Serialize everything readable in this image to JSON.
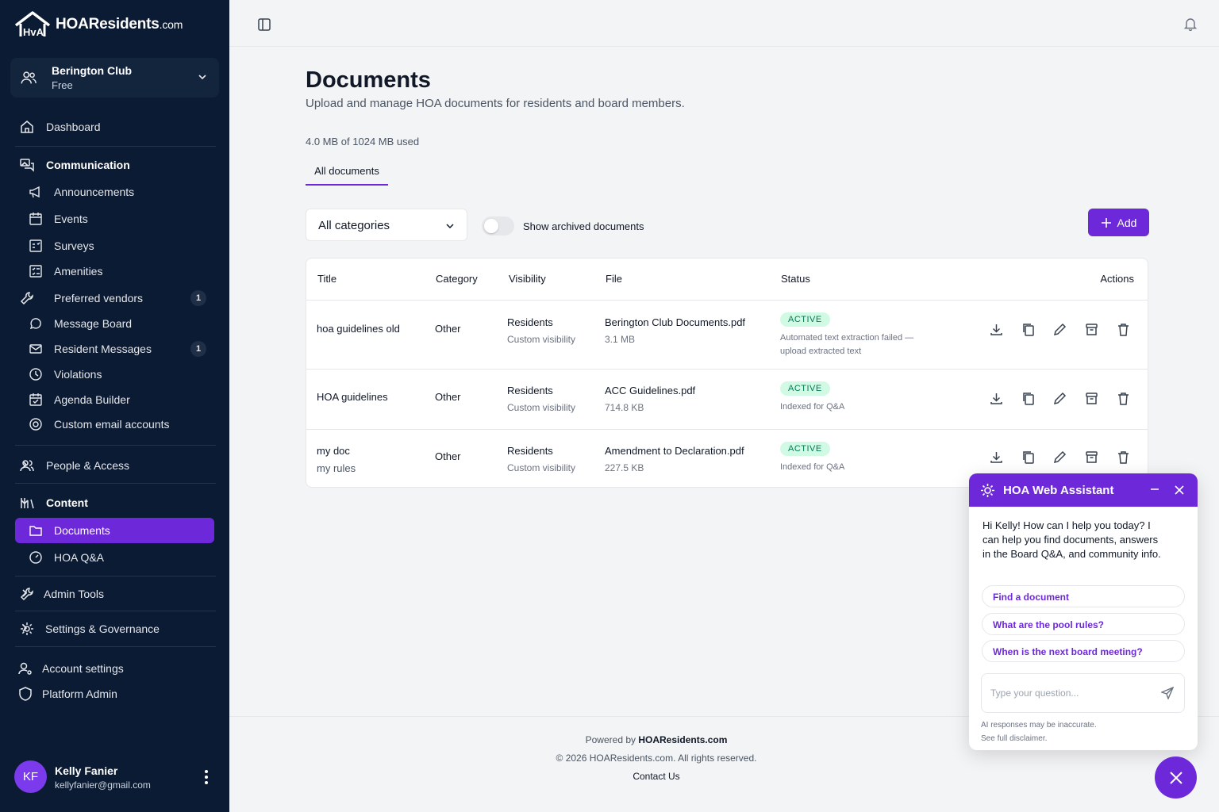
{
  "brand": {
    "name": "HOAResidents",
    "suffix": ".com"
  },
  "club": {
    "name": "Berington Club",
    "plan": "Free"
  },
  "nav": {
    "dashboard": "Dashboard",
    "communication": "Communication",
    "announcements": "Announcements",
    "events": "Events",
    "surveys": "Surveys",
    "amenities": "Amenities",
    "preferred_vendors": "Preferred vendors",
    "preferred_vendors_count": "1",
    "message_board": "Message Board",
    "resident_messages": "Resident Messages",
    "resident_messages_count": "1",
    "violations": "Violations",
    "agenda_builder": "Agenda Builder",
    "custom_email": "Custom email accounts",
    "people_access": "People & Access",
    "content": "Content",
    "documents": "Documents",
    "hoa_qa": "HOA Q&A",
    "admin_tools": "Admin Tools",
    "settings_governance": "Settings & Governance",
    "account_settings": "Account settings",
    "platform_admin": "Platform Admin"
  },
  "user": {
    "initials": "KF",
    "name": "Kelly Fanier",
    "email": "kellyfanier@gmail.com"
  },
  "page": {
    "title": "Documents",
    "subtitle": "Upload and manage HOA documents for residents and board members.",
    "usage": "4.0 MB of 1024 MB used",
    "tab": "All documents",
    "category_select": "All categories",
    "archived_toggle": "Show archived documents",
    "add_label": "Add"
  },
  "table": {
    "headers": {
      "title": "Title",
      "category": "Category",
      "visibility": "Visibility",
      "file": "File",
      "status": "Status",
      "actions": "Actions"
    },
    "rows": [
      {
        "title": "hoa guidelines old",
        "subtitle": "",
        "category": "Other",
        "visibility": "Residents",
        "visibility_note": "Custom visibility",
        "file": "Berington Club Documents.pdf",
        "size": "3.1 MB",
        "status": "ACTIVE",
        "status_note": "Automated text extraction failed — upload extracted text"
      },
      {
        "title": "HOA guidelines",
        "subtitle": "",
        "category": "Other",
        "visibility": "Residents",
        "visibility_note": "Custom visibility",
        "file": "ACC Guidelines.pdf",
        "size": "714.8 KB",
        "status": "ACTIVE",
        "status_note": "Indexed for Q&A"
      },
      {
        "title": "my doc",
        "subtitle": "my rules",
        "category": "Other",
        "visibility": "Residents",
        "visibility_note": "Custom visibility",
        "file": "Amendment to Declaration.pdf",
        "size": "227.5 KB",
        "status": "ACTIVE",
        "status_note": "Indexed for Q&A"
      }
    ]
  },
  "footer": {
    "powered_prefix": "Powered by",
    "powered_brand": "HOAResidents.com",
    "copyright": "© 2026 HOAResidents.com. All rights reserved.",
    "contact": "Contact Us"
  },
  "assistant": {
    "title": "HOA Web Assistant",
    "greeting": "Hi Kelly! How can I help you today? I can help you find documents, answers in the Board Q&A, and community info.",
    "chips": [
      "Find a document",
      "What are the pool rules?",
      "When is the next board meeting?"
    ],
    "placeholder": "Type your question...",
    "disclaimer_1": "AI responses may be inaccurate.",
    "disclaimer_2": "See full disclaimer."
  },
  "colors": {
    "sidebar": "#0b1b33",
    "accent": "#6d28d9",
    "status_bg": "#d1fae5",
    "status_text": "#047857"
  }
}
